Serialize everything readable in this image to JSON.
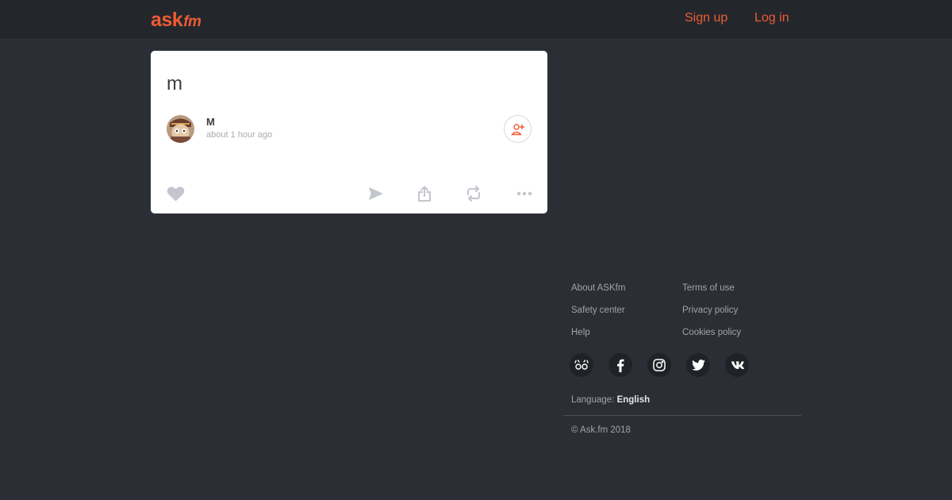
{
  "header": {
    "logo": {
      "main": "ask",
      "suffix": "fm"
    },
    "sign_up": "Sign up",
    "log_in": "Log in"
  },
  "post": {
    "question": "m",
    "author": "M",
    "time": "about 1 hour ago"
  },
  "icons": {
    "follow": "add-user-icon",
    "like": "heart-icon",
    "send": "send-icon",
    "share": "share-icon",
    "repost": "repost-icon",
    "more": "more-icon"
  },
  "footer": {
    "links_left": [
      "About ASKfm",
      "Safety center",
      "Help"
    ],
    "links_right": [
      "Terms of use",
      "Privacy policy",
      "Cookies policy"
    ],
    "social": [
      "askfm-icon",
      "facebook-icon",
      "instagram-icon",
      "twitter-icon",
      "vk-icon"
    ],
    "language_label": "Language:",
    "language_value": "English",
    "copyright": "© Ask.fm 2018"
  },
  "colors": {
    "accent": "#ee5b34",
    "background": "#2b2f35",
    "header": "#23272c",
    "card": "#ffffff"
  }
}
